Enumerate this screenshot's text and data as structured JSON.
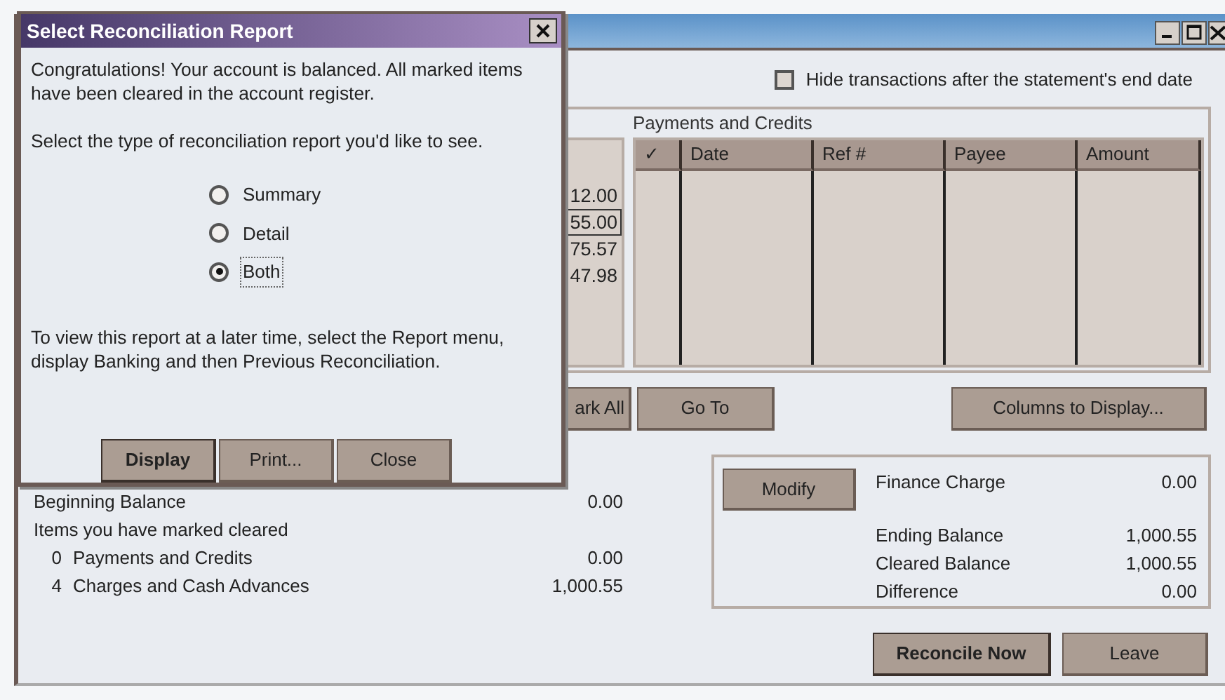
{
  "hide_option": {
    "label": "Hide transactions after the statement's end date",
    "checked": false
  },
  "charges_table": {
    "amounts": [
      {
        "text": "12.00",
        "focused": false
      },
      {
        "text": "55.00",
        "focused": true
      },
      {
        "text": "75.57",
        "focused": false
      },
      {
        "text": "47.98",
        "focused": false
      }
    ]
  },
  "payments_table": {
    "title": "Payments and Credits",
    "columns": [
      "✓",
      "Date",
      "Ref #",
      "Payee",
      "Amount"
    ]
  },
  "list_buttons": [
    "ark All",
    "Go To",
    "Columns to Display..."
  ],
  "summary": [
    {
      "kind": "total",
      "label": "Beginning Balance",
      "amount": "0.00"
    },
    {
      "kind": "heading",
      "label": "Items you have marked cleared"
    },
    {
      "kind": "item",
      "count": "0",
      "label": "Payments and Credits",
      "amount": "0.00"
    },
    {
      "kind": "item",
      "count": "4",
      "label": "Charges and Cash Advances",
      "amount": "1,000.55"
    }
  ],
  "balance_box": {
    "button": "Modify",
    "rows": [
      {
        "label": "Finance Charge",
        "amount": "0.00"
      },
      {
        "label": "Ending Balance",
        "amount": "1,000.55"
      },
      {
        "label": "Cleared Balance",
        "amount": "1,000.55"
      },
      {
        "label": "Difference",
        "amount": "0.00"
      }
    ]
  },
  "actions": [
    {
      "label": "Reconcile Now",
      "default": true
    },
    {
      "label": "Leave",
      "default": false
    }
  ],
  "dialog": {
    "title": "Select Reconciliation Report",
    "message": "Congratulations! Your account is balanced. All marked items have been cleared in the account register.",
    "prompt": "Select the type of reconciliation report you'd like to see.",
    "options": [
      {
        "label": "Summary",
        "selected": false
      },
      {
        "label": "Detail",
        "selected": false
      },
      {
        "label": "Both",
        "selected": true
      }
    ],
    "note": "To view this report at a later time, select the Report menu, display Banking and then Previous Reconciliation.",
    "buttons": [
      {
        "label": "Display",
        "default": true
      },
      {
        "label": "Print...",
        "default": false
      },
      {
        "label": "Close",
        "default": false
      }
    ]
  }
}
